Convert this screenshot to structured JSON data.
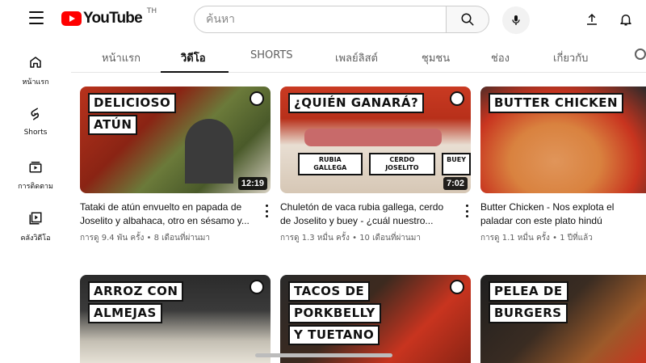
{
  "header": {
    "logo_text": "YouTube",
    "logo_country": "TH",
    "search_placeholder": "ค้นหา",
    "icons": [
      "hamburger-icon",
      "search-icon",
      "mic-icon",
      "upload-icon",
      "bell-icon"
    ]
  },
  "sidebar": {
    "items": [
      {
        "label": "หน้าแรก",
        "icon": "home-icon"
      },
      {
        "label": "Shorts",
        "icon": "shorts-icon"
      },
      {
        "label": "การติดตาม",
        "icon": "subscriptions-icon"
      },
      {
        "label": "คลังวิดีโอ",
        "icon": "library-icon"
      }
    ]
  },
  "tabs": [
    {
      "label": "หน้าแรก",
      "active": false
    },
    {
      "label": "วิดีโอ",
      "active": true
    },
    {
      "label": "SHORTS",
      "active": false
    },
    {
      "label": "เพลย์ลิสต์",
      "active": false
    },
    {
      "label": "ชุมชน",
      "active": false
    },
    {
      "label": "ช่อง",
      "active": false
    },
    {
      "label": "เกี่ยวกับ",
      "active": false
    }
  ],
  "videos": [
    {
      "thumb_lines": [
        "DELICIOSO",
        "ATÚN"
      ],
      "duration": "12:19",
      "title": "Tataki de atún envuelto en papada de Joselito y albahaca, otro en sésamo y...",
      "stats": "การดู 9.4 พัน ครั้ง • 8 เดือนที่ผ่านมา"
    },
    {
      "thumb_lines": [
        "¿QUIÉN GANARÁ?"
      ],
      "thumb_labels": [
        "RUBIA GALLEGA",
        "CERDO JOSELITO",
        "BUEY"
      ],
      "duration": "7:02",
      "title": "Chuletón de vaca rubia gallega, cerdo de Joselito y buey - ¿cuál nuestro...",
      "stats": "การดู 1.3 หมื่น ครั้ง • 10 เดือนที่ผ่านมา"
    },
    {
      "thumb_lines": [
        "BUTTER CHICKEN"
      ],
      "title": "Butter Chicken - Nos explota el paladar con este plato hindú",
      "stats": "การดู 1.1 หมื่น ครั้ง • 1 ปีที่แล้ว"
    },
    {
      "thumb_lines": [
        "ARROZ CON",
        "ALMEJAS"
      ]
    },
    {
      "thumb_lines": [
        "TACOS DE",
        "PORKBELLY",
        "Y TUETANO"
      ]
    },
    {
      "thumb_lines": [
        "PELEA DE",
        "BURGERS"
      ]
    }
  ],
  "colors": {
    "brand_red": "#ff0000",
    "thumb_red": "#c8341f"
  }
}
